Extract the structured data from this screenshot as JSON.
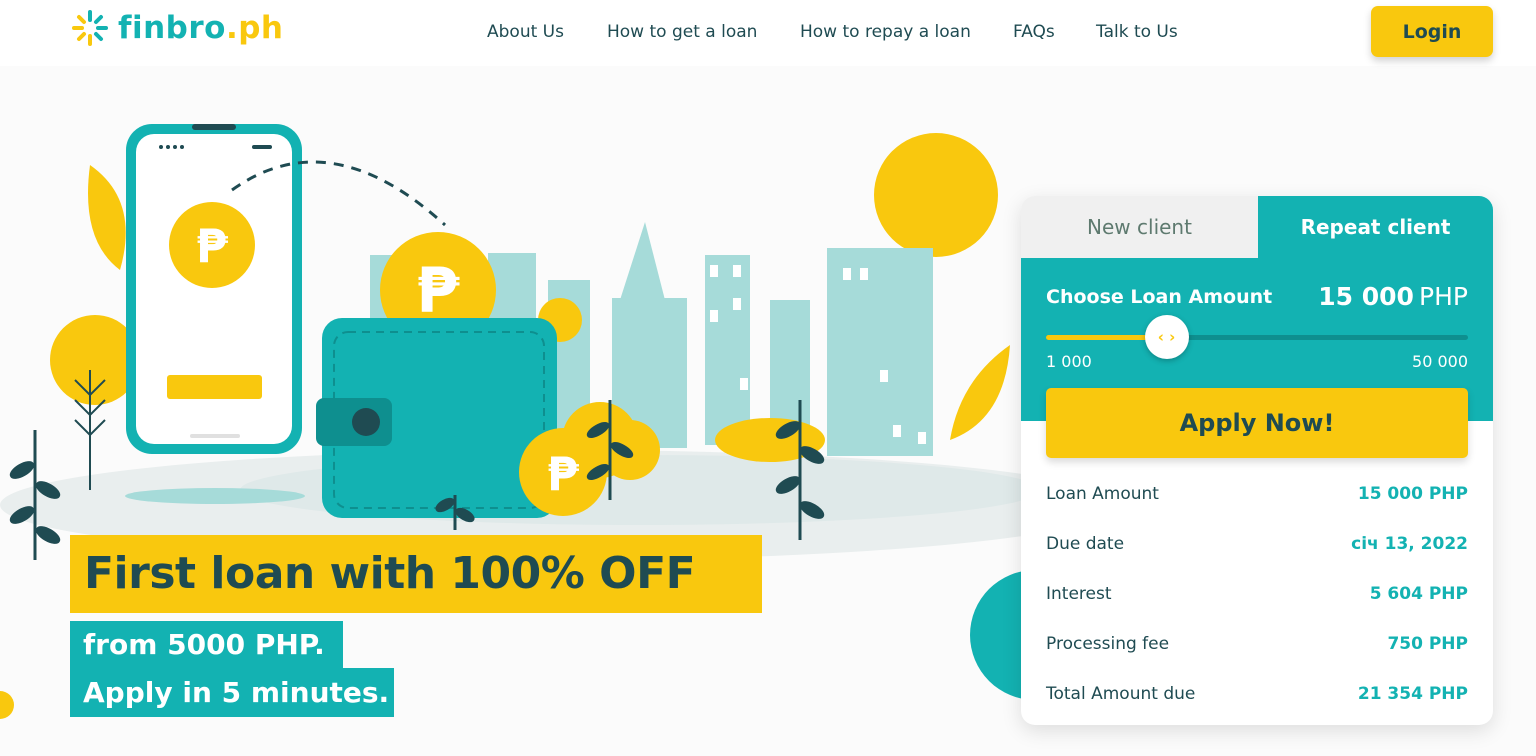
{
  "header": {
    "logo_text": "finbro",
    "logo_suffix": ".ph",
    "nav": [
      "About Us",
      "How to get a loan",
      "How to repay a loan",
      "FAQs",
      "Talk to Us"
    ],
    "login_label": "Login"
  },
  "hero": {
    "headline": "First loan with 100% OFF",
    "line1": "from 5000 PHP.",
    "line2": "Apply in 5 minutes."
  },
  "calculator": {
    "tabs": {
      "new": "New client",
      "repeat": "Repeat client"
    },
    "active_tab": "Repeat client",
    "choose_label": "Choose Loan Amount",
    "amount_value": "15 000",
    "amount_currency": "PHP",
    "slider": {
      "min_label": "1 000",
      "max_label": "50 000",
      "min": 1000,
      "max": 50000,
      "value": 15000
    },
    "thumb_glyph": "‹ ›",
    "apply_label": "Apply Now!",
    "rows": [
      {
        "label": "Loan Amount",
        "value": "15 000 PHP"
      },
      {
        "label": "Due date",
        "value": "січ 13, 2022"
      },
      {
        "label": "Interest",
        "value": "5 604 PHP"
      },
      {
        "label": "Processing fee",
        "value": "750 PHP"
      },
      {
        "label": "Total Amount due",
        "value": "21 354 PHP"
      }
    ]
  },
  "illustration": {
    "coin_symbol": "₱",
    "icons": [
      "phone-illustration",
      "wallet-illustration",
      "peso-coin-icon",
      "city-skyline",
      "sun",
      "plants"
    ]
  },
  "colors": {
    "teal": "#13b2b2",
    "yellow": "#f9c80e",
    "dark_text": "#1f4b52",
    "light_teal": "#a6dbd9",
    "light_gray": "#f0f0f0"
  }
}
